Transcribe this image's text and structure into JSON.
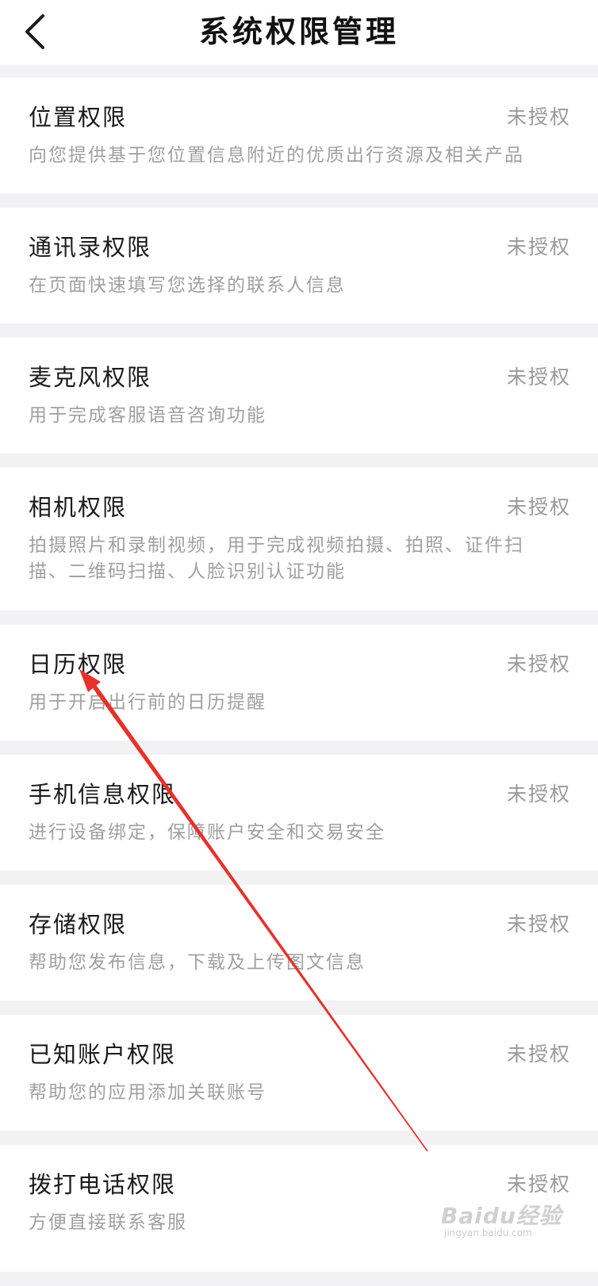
{
  "header": {
    "title": "系统权限管理",
    "back_icon": "chevron-left-icon"
  },
  "permissions": [
    {
      "title": "位置权限",
      "status": "未授权",
      "desc": "向您提供基于您位置信息附近的优质出行资源及相关产品"
    },
    {
      "title": "通讯录权限",
      "status": "未授权",
      "desc": "在页面快速填写您选择的联系人信息"
    },
    {
      "title": "麦克风权限",
      "status": "未授权",
      "desc": "用于完成客服语音咨询功能"
    },
    {
      "title": "相机权限",
      "status": "未授权",
      "desc": "拍摄照片和录制视频，用于完成视频拍摄、拍照、证件扫描、二维码扫描、人脸识别认证功能"
    },
    {
      "title": "日历权限",
      "status": "未授权",
      "desc": "用于开启出行前的日历提醒"
    },
    {
      "title": "手机信息权限",
      "status": "未授权",
      "desc": "进行设备绑定，保障账户安全和交易安全"
    },
    {
      "title": "存储权限",
      "status": "未授权",
      "desc": "帮助您发布信息，下载及上传图文信息"
    },
    {
      "title": "已知账户权限",
      "status": "未授权",
      "desc": "帮助您的应用添加关联账号"
    },
    {
      "title": "拨打电话权限",
      "status": "未授权",
      "desc": "方便直接联系客服"
    }
  ],
  "colors": {
    "page_bg": "#f2f2f4",
    "card_bg": "#ffffff",
    "title_text": "#1a1a1a",
    "muted_text": "#9a9a9a",
    "annotation_arrow": "#e8302a"
  },
  "watermark": {
    "text": "Baidu经验",
    "url": "jingyan.baidu.com"
  }
}
